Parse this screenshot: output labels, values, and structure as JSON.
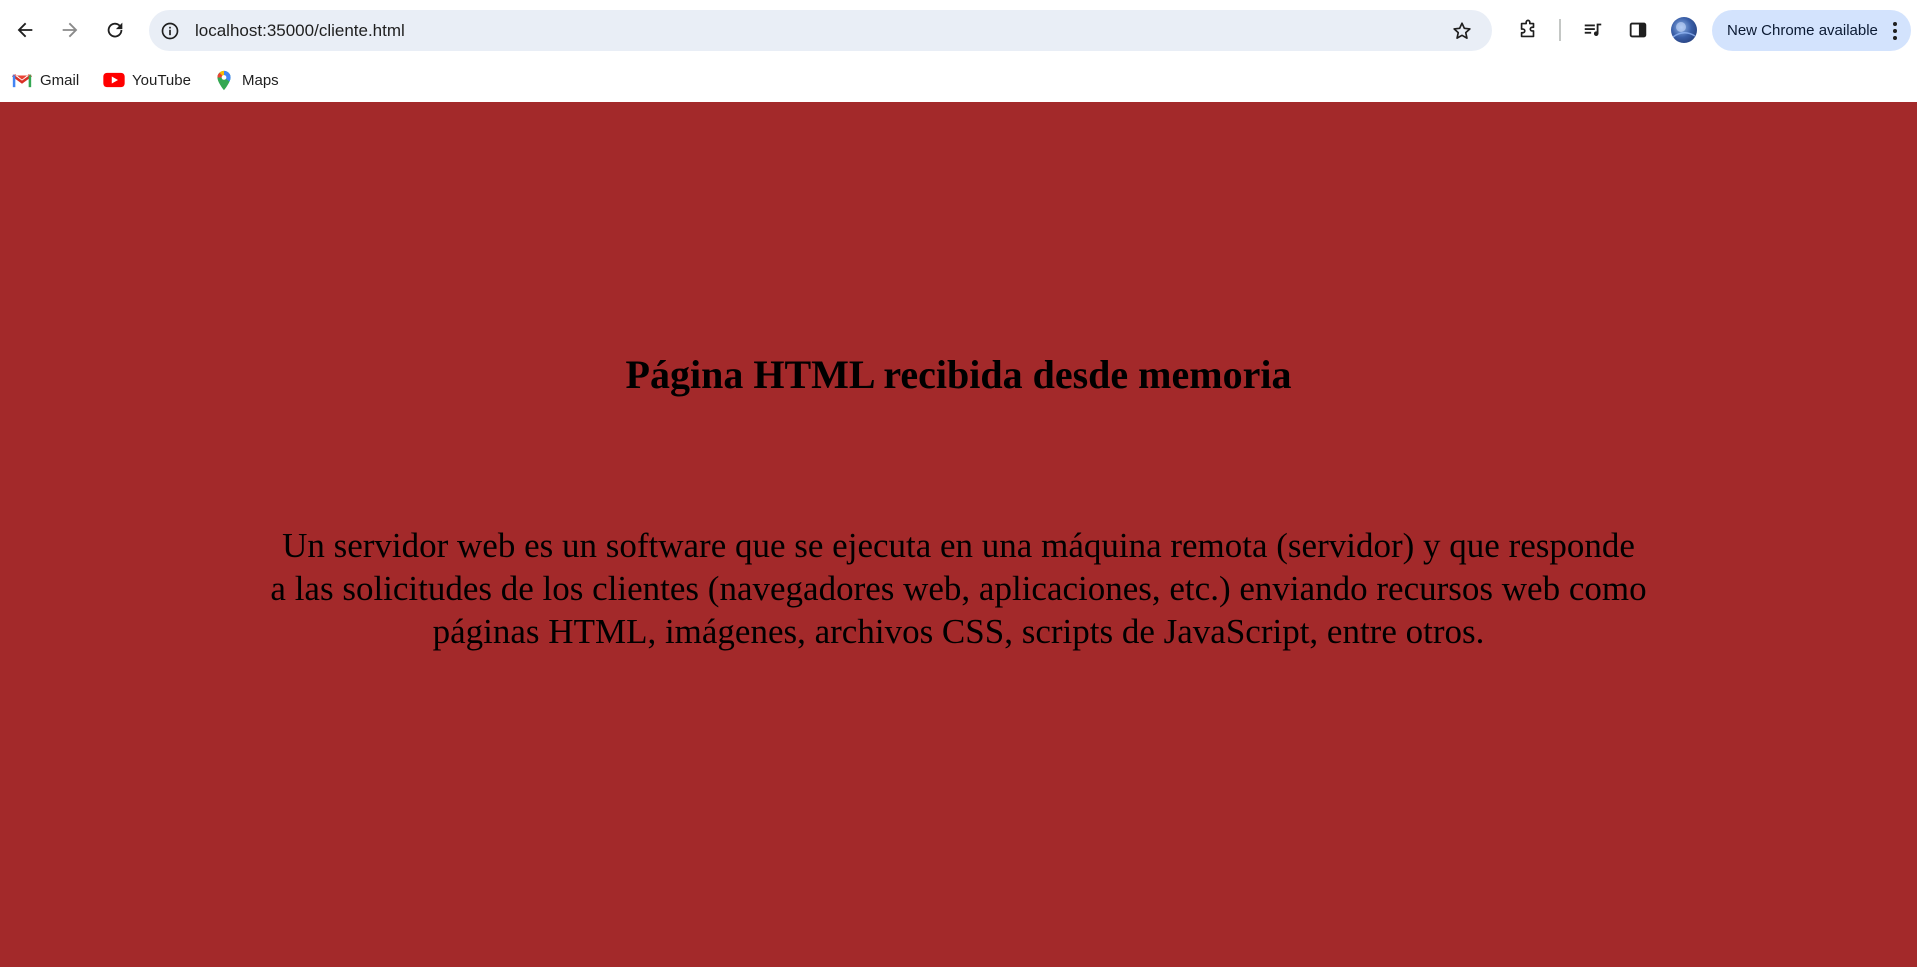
{
  "browser": {
    "url": "localhost:35000/cliente.html",
    "update_label": "New Chrome available",
    "icons": {
      "back": "arrow-left",
      "forward": "arrow-right",
      "reload": "reload",
      "site_info": "info-circle",
      "bookmark": "star",
      "extensions": "puzzle",
      "media": "music-queue",
      "side_panel": "side-panel",
      "profile": "avatar",
      "menu": "vertical-dots"
    }
  },
  "bookmarks": [
    {
      "label": "Gmail",
      "icon": "gmail-icon"
    },
    {
      "label": "YouTube",
      "icon": "youtube-icon"
    },
    {
      "label": "Maps",
      "icon": "maps-icon"
    }
  ],
  "page": {
    "background": "#a3292a",
    "heading": "Página HTML recibida desde memoria",
    "paragraph": "Un servidor web es un software que se ejecuta en una máquina remota (servidor) y que responde a las solicitudes de los clientes (navegadores web, aplicaciones, etc.) enviando recursos web como páginas HTML, imágenes, archivos CSS, scripts de JavaScript, entre otros."
  }
}
